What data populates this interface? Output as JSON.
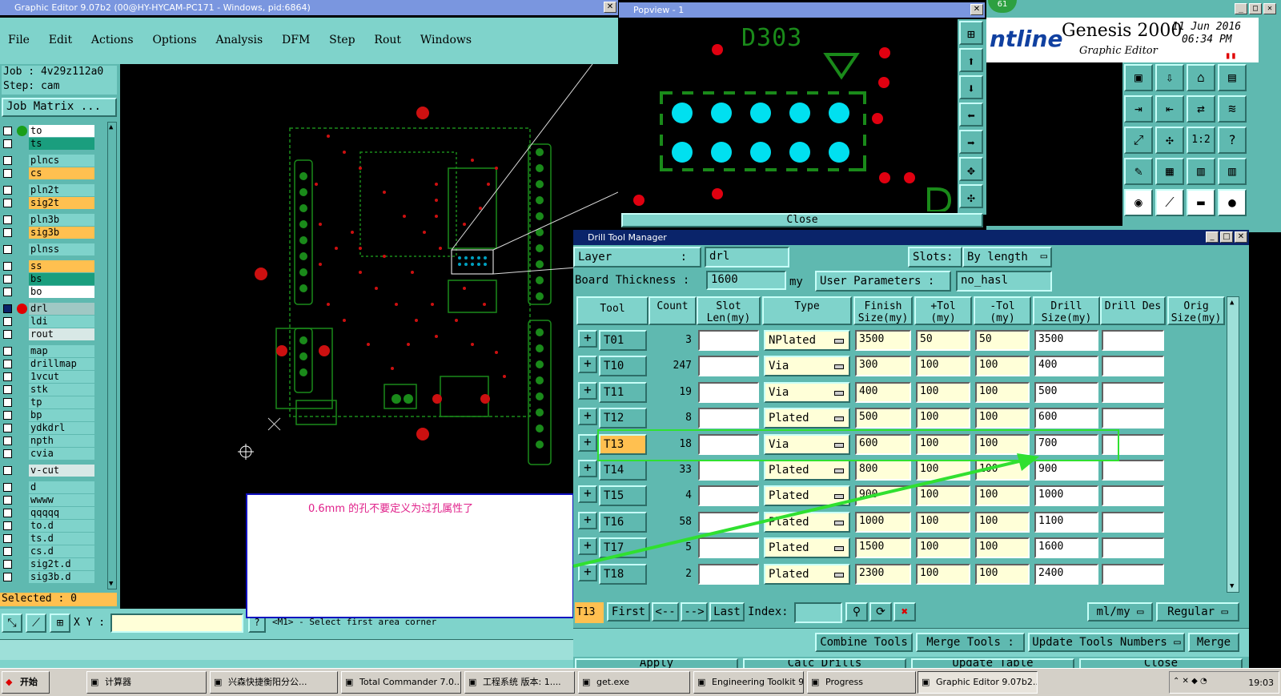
{
  "main_window": {
    "title": "Graphic Editor 9.07b2 (00@HY-HYCAM-PC171 - Windows, pid:6864)",
    "menu": [
      "File",
      "Edit",
      "Actions",
      "Options",
      "Analysis",
      "DFM",
      "Step",
      "Rout",
      "Windows"
    ],
    "job_label": "Job : 4v29z112a0",
    "step_label": "Step: cam",
    "job_matrix": "Job Matrix ...",
    "layers": [
      {
        "name": "to",
        "color": "#ffffff",
        "dot": "#1a9e1a"
      },
      {
        "name": "ts",
        "color": "#1a9e7e"
      },
      {
        "name": "plncs",
        "color": "#7fd3cb"
      },
      {
        "name": "cs",
        "color": "#ffc050"
      },
      {
        "name": "pln2t",
        "color": "#7fd3cb"
      },
      {
        "name": "sig2t",
        "color": "#ffc050"
      },
      {
        "name": "pln3b",
        "color": "#7fd3cb"
      },
      {
        "name": "sig3b",
        "color": "#ffc050"
      },
      {
        "name": "plnss",
        "color": "#7fd3cb"
      },
      {
        "name": "ss",
        "color": "#ffc050"
      },
      {
        "name": "bs",
        "color": "#1a9e7e"
      },
      {
        "name": "bo",
        "color": "#ffffff"
      },
      {
        "name": "drl",
        "color": "#a0c8c4",
        "dot": "#e00000",
        "active": true
      },
      {
        "name": "ldi",
        "color": "#7fd3cb"
      },
      {
        "name": "rout",
        "color": "#d8e8e6"
      },
      {
        "name": "map",
        "color": "#7fd3cb"
      },
      {
        "name": "drillmap",
        "color": "#7fd3cb"
      },
      {
        "name": "1vcut",
        "color": "#7fd3cb"
      },
      {
        "name": "stk",
        "color": "#7fd3cb"
      },
      {
        "name": "tp",
        "color": "#7fd3cb"
      },
      {
        "name": "bp",
        "color": "#7fd3cb"
      },
      {
        "name": "ydkdrl",
        "color": "#7fd3cb"
      },
      {
        "name": "npth",
        "color": "#7fd3cb"
      },
      {
        "name": "cvia",
        "color": "#7fd3cb"
      },
      {
        "name": "v-cut",
        "color": "#d8e8e6"
      },
      {
        "name": "d",
        "color": "#7fd3cb"
      },
      {
        "name": "wwww",
        "color": "#7fd3cb"
      },
      {
        "name": "qqqqq",
        "color": "#7fd3cb"
      },
      {
        "name": "to.d",
        "color": "#7fd3cb"
      },
      {
        "name": "ts.d",
        "color": "#7fd3cb"
      },
      {
        "name": "cs.d",
        "color": "#7fd3cb"
      },
      {
        "name": "sig2t.d",
        "color": "#7fd3cb"
      },
      {
        "name": "sig3b.d",
        "color": "#7fd3cb"
      }
    ],
    "selected": "Selected : 0",
    "xy_label": "X Y :",
    "status_msg": "<M1> - Select first area corner"
  },
  "annotation_note": "0.6mm 的孔不要定义为过孔属性了",
  "popview": {
    "title": "Popview - 1",
    "ref_label": "D303",
    "close_label": "Close"
  },
  "genesis": {
    "brand": "ntline",
    "product": "Genesis 2000",
    "subtitle": "Graphic Editor",
    "date": "11 Jun 2016",
    "time": "06:34 PM",
    "badge": "61",
    "scale_label": "1:2"
  },
  "drill": {
    "title": "Drill Tool Manager",
    "layer_label": "Layer",
    "layer_value": "drl",
    "slots_label": "Slots:",
    "slots_value": "By length",
    "board_thickness_label": "Board Thickness :",
    "board_thickness_value": "1600",
    "board_thickness_unit": "my",
    "user_params_label": "User Parameters :",
    "user_params_value": "no_hasl",
    "headers": [
      "Tool",
      "Count",
      "Slot Len(my)",
      "Type",
      "Finish Size(my)",
      "+Tol (my)",
      "-Tol (my)",
      "Drill Size(my)",
      "Drill Des",
      "Orig Size(my)"
    ],
    "rows": [
      {
        "tool": "T01",
        "count": "3",
        "type": "NPlated",
        "finish": "3500",
        "ptol": "50",
        "ntol": "50",
        "drill": "3500"
      },
      {
        "tool": "T10",
        "count": "247",
        "type": "Via",
        "finish": "300",
        "ptol": "100",
        "ntol": "100",
        "drill": "400"
      },
      {
        "tool": "T11",
        "count": "19",
        "type": "Via",
        "finish": "400",
        "ptol": "100",
        "ntol": "100",
        "drill": "500"
      },
      {
        "tool": "T12",
        "count": "8",
        "type": "Plated",
        "finish": "500",
        "ptol": "100",
        "ntol": "100",
        "drill": "600"
      },
      {
        "tool": "T13",
        "count": "18",
        "type": "Via",
        "finish": "600",
        "ptol": "100",
        "ntol": "100",
        "drill": "700",
        "highlight": true
      },
      {
        "tool": "T14",
        "count": "33",
        "type": "Plated",
        "finish": "800",
        "ptol": "100",
        "ntol": "100",
        "drill": "900"
      },
      {
        "tool": "T15",
        "count": "4",
        "type": "Plated",
        "finish": "900",
        "ptol": "100",
        "ntol": "100",
        "drill": "1000"
      },
      {
        "tool": "T16",
        "count": "58",
        "type": "Plated",
        "finish": "1000",
        "ptol": "100",
        "ntol": "100",
        "drill": "1100"
      },
      {
        "tool": "T17",
        "count": "5",
        "type": "Plated",
        "finish": "1500",
        "ptol": "100",
        "ntol": "100",
        "drill": "1600"
      },
      {
        "tool": "T18",
        "count": "2",
        "type": "Plated",
        "finish": "2300",
        "ptol": "100",
        "ntol": "100",
        "drill": "2400"
      }
    ],
    "current_tool": "T13",
    "nav": {
      "first": "First",
      "prev": "<--",
      "next": "-->",
      "last": "Last",
      "index": "Index:"
    },
    "unit_select": "ml/my",
    "mode_select": "Regular",
    "actions": [
      "Combine Tools",
      "Merge Tools :",
      "Update Tools Numbers",
      "Merge"
    ],
    "bottom_actions": [
      "Apply",
      "Calc Drills",
      "Update Table",
      "Close"
    ]
  },
  "taskbar": {
    "start": "开始",
    "tasks": [
      "计算器",
      "兴森快捷衡阳分公...",
      "Total Commander 7.0...",
      "工程系统  版本: 1....",
      "get.exe",
      "Engineering Toolkit 9....",
      "Progress",
      "Graphic Editor 9.07b2..."
    ],
    "clock": "19:03"
  }
}
